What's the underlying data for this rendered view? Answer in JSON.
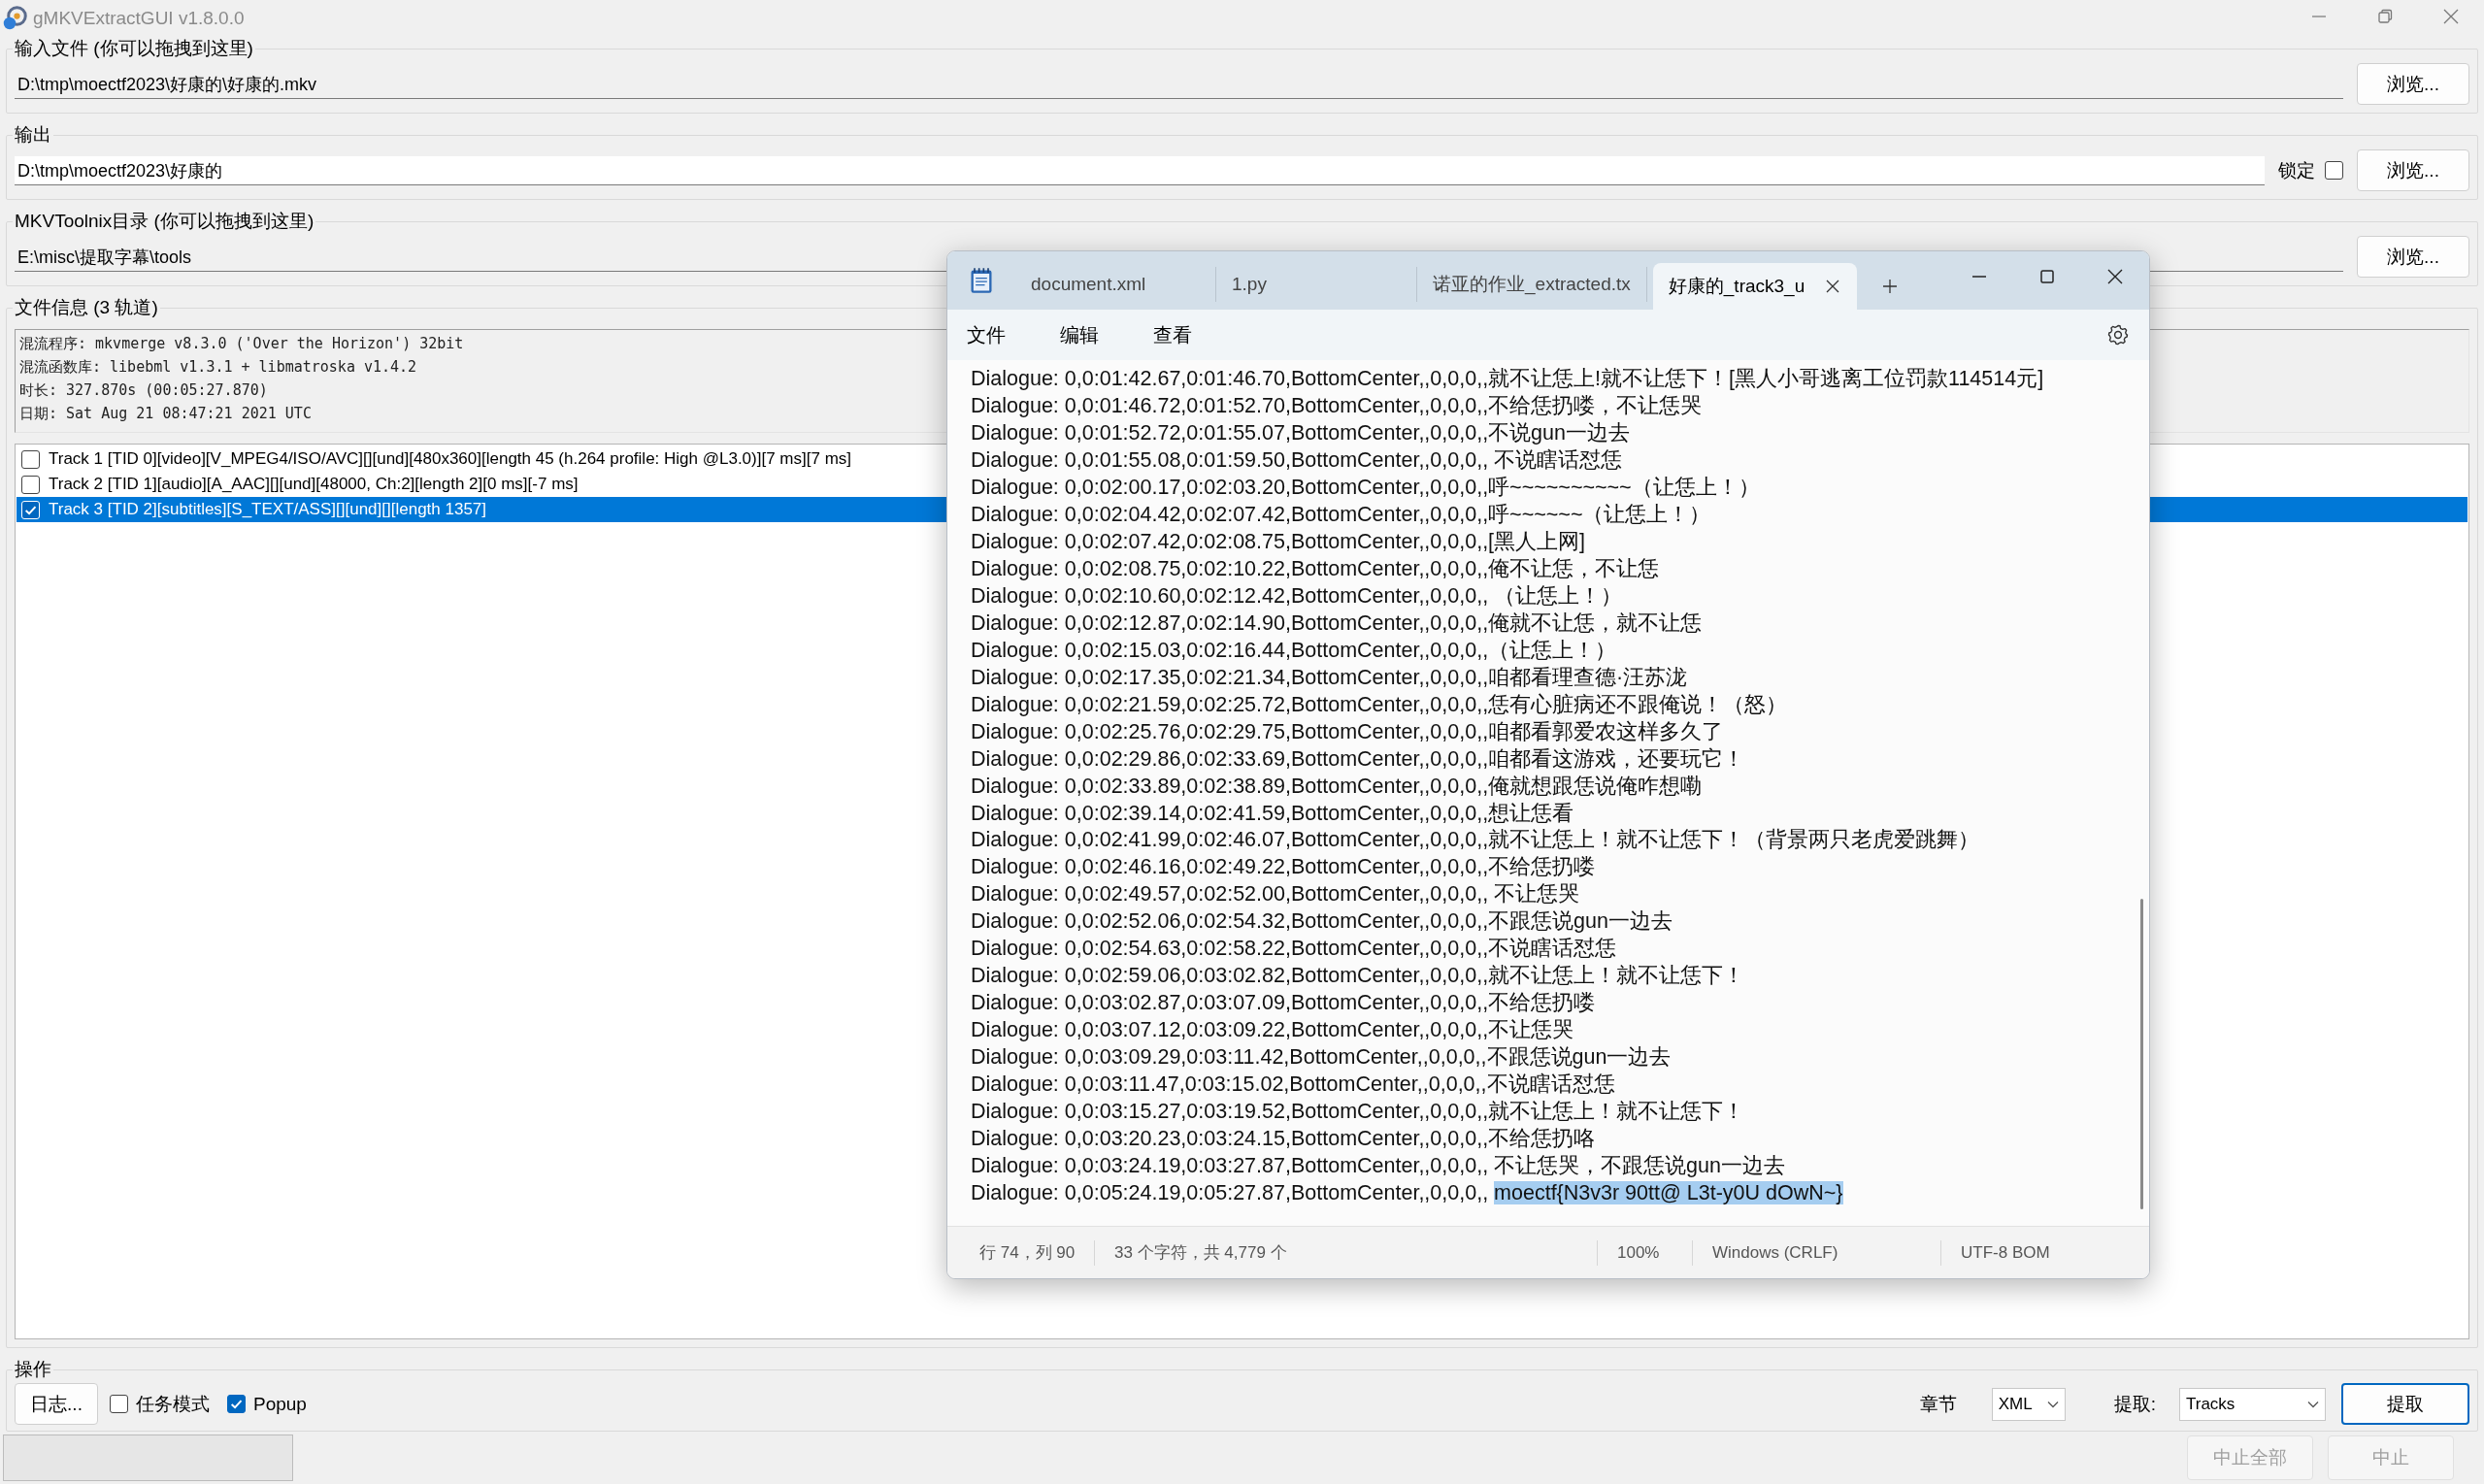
{
  "window": {
    "title": "gMKVExtractGUI v1.8.0.0"
  },
  "input_file": {
    "label": "输入文件 (你可以拖拽到这里)",
    "value": "D:\\tmp\\moectf2023\\好康的\\好康的.mkv",
    "editable": false,
    "browse_button": "浏览..."
  },
  "output": {
    "label": "输出",
    "value": "D:\\tmp\\moectf2023\\好康的",
    "editable": true,
    "lock_label": "锁定",
    "lock_checked": false,
    "browse_button": "浏览..."
  },
  "mkvtoolnix_dir": {
    "label": "MKVToolnix目录 (你可以拖拽到这里)",
    "value": "E:\\misc\\提取字幕\\tools",
    "editable": false,
    "browse_button": "浏览..."
  },
  "file_info": {
    "label": "文件信息 (3 轨道)",
    "details": [
      "混流程序: mkvmerge v8.3.0 ('Over the Horizon') 32bit",
      "混流函数库: libebml v1.3.1 + libmatroska v1.4.2",
      "时长: 327.870s (00:05:27.870)",
      "日期: Sat Aug 21 08:47:21 2021 UTC"
    ],
    "tracks": [
      {
        "label": "Track 1 [TID 0][video][V_MPEG4/ISO/AVC][][und][480x360][length 45 (h.264 profile: High @L3.0)][7 ms][7 ms]",
        "checked": false,
        "selected": false
      },
      {
        "label": "Track 2 [TID 1][audio][A_AAC][][und][48000, Ch:2][length 2][0 ms][-7 ms]",
        "checked": false,
        "selected": false
      },
      {
        "label": "Track 3 [TID 2][subtitles][S_TEXT/ASS][][und][][length 1357]",
        "checked": true,
        "selected": true
      }
    ]
  },
  "actions": {
    "label": "操作",
    "log_button": "日志...",
    "task_mode": {
      "label": "任务模式",
      "checked": false
    },
    "popup": {
      "label": "Popup",
      "checked": true
    },
    "chapters_label": "章节",
    "chapters_format": "XML",
    "extract_label": "提取:",
    "extract_mode": "Tracks",
    "extract_button": "提取"
  },
  "status_bar": {
    "progress": {
      "level": 0
    },
    "abort_all_button": {
      "label": "中止全部",
      "disabled": true
    },
    "abort_button": {
      "label": "中止",
      "disabled": true
    }
  },
  "notepad": {
    "tabs": [
      {
        "label": "document.xml",
        "selected": false
      },
      {
        "label": "1.py",
        "selected": false
      },
      {
        "label": "诺亚的作业_extracted.tx",
        "selected": false
      },
      {
        "label": "好康的_track3_u",
        "selected": true
      }
    ],
    "menu": [
      "文件",
      "编辑",
      "查看"
    ],
    "lines": [
      {
        "text": "Dialogue: 0,0:01:42.67,0:01:46.70,BottomCenter,,0,0,0,,就不让恁上!就不让恁下！[黑人小哥逃离工位罚款114514元]"
      },
      {
        "text": "Dialogue: 0,0:01:46.72,0:01:52.70,BottomCenter,,0,0,0,,不给恁扔喽，不让恁哭"
      },
      {
        "text": "Dialogue: 0,0:01:52.72,0:01:55.07,BottomCenter,,0,0,0,,不说gun一边去"
      },
      {
        "text": "Dialogue: 0,0:01:55.08,0:01:59.50,BottomCenter,,0,0,0,, 不说瞎话怼恁"
      },
      {
        "text": "Dialogue: 0,0:02:00.17,0:02:03.20,BottomCenter,,0,0,0,,呼~~~~~~~~~~（让恁上！）"
      },
      {
        "text": "Dialogue: 0,0:02:04.42,0:02:07.42,BottomCenter,,0,0,0,,呼~~~~~~（让恁上！）"
      },
      {
        "text": "Dialogue: 0,0:02:07.42,0:02:08.75,BottomCenter,,0,0,0,,[黑人上网]"
      },
      {
        "text": "Dialogue: 0,0:02:08.75,0:02:10.22,BottomCenter,,0,0,0,,俺不让恁，不让恁"
      },
      {
        "text": "Dialogue: 0,0:02:10.60,0:02:12.42,BottomCenter,,0,0,0,, （让恁上！）"
      },
      {
        "text": "Dialogue: 0,0:02:12.87,0:02:14.90,BottomCenter,,0,0,0,,俺就不让恁，就不让恁"
      },
      {
        "text": "Dialogue: 0,0:02:15.03,0:02:16.44,BottomCenter,,0,0,0,,（让恁上！）"
      },
      {
        "text": "Dialogue: 0,0:02:17.35,0:02:21.34,BottomCenter,,0,0,0,,咱都看理查德·汪苏泷"
      },
      {
        "text": "Dialogue: 0,0:02:21.59,0:02:25.72,BottomCenter,,0,0,0,,恁有心脏病还不跟俺说！（怒）"
      },
      {
        "text": "Dialogue: 0,0:02:25.76,0:02:29.75,BottomCenter,,0,0,0,,咱都看郭爱农这样多久了"
      },
      {
        "text": "Dialogue: 0,0:02:29.86,0:02:33.69,BottomCenter,,0,0,0,,咱都看这游戏，还要玩它！"
      },
      {
        "text": "Dialogue: 0,0:02:33.89,0:02:38.89,BottomCenter,,0,0,0,,俺就想跟恁说俺咋想嘞"
      },
      {
        "text": "Dialogue: 0,0:02:39.14,0:02:41.59,BottomCenter,,0,0,0,,想让恁看"
      },
      {
        "text": "Dialogue: 0,0:02:41.99,0:02:46.07,BottomCenter,,0,0,0,,就不让恁上！就不让恁下！（背景两只老虎爱跳舞）"
      },
      {
        "text": "Dialogue: 0,0:02:46.16,0:02:49.22,BottomCenter,,0,0,0,,不给恁扔喽"
      },
      {
        "text": "Dialogue: 0,0:02:49.57,0:02:52.00,BottomCenter,,0,0,0,, 不让恁哭"
      },
      {
        "text": "Dialogue: 0,0:02:52.06,0:02:54.32,BottomCenter,,0,0,0,,不跟恁说gun一边去"
      },
      {
        "text": "Dialogue: 0,0:02:54.63,0:02:58.22,BottomCenter,,0,0,0,,不说瞎话怼恁"
      },
      {
        "text": "Dialogue: 0,0:02:59.06,0:03:02.82,BottomCenter,,0,0,0,,就不让恁上！就不让恁下！"
      },
      {
        "text": "Dialogue: 0,0:03:02.87,0:03:07.09,BottomCenter,,0,0,0,,不给恁扔喽"
      },
      {
        "text": "Dialogue: 0,0:03:07.12,0:03:09.22,BottomCenter,,0,0,0,,不让恁哭"
      },
      {
        "text": "Dialogue: 0,0:03:09.29,0:03:11.42,BottomCenter,,0,0,0,,不跟恁说gun一边去"
      },
      {
        "text": "Dialogue: 0,0:03:11.47,0:03:15.02,BottomCenter,,0,0,0,,不说瞎话怼恁"
      },
      {
        "text": "Dialogue: 0,0:03:15.27,0:03:19.52,BottomCenter,,0,0,0,,就不让恁上！就不让恁下！"
      },
      {
        "text": "Dialogue: 0,0:03:20.23,0:03:24.15,BottomCenter,,0,0,0,,不给恁扔咯"
      },
      {
        "text": "Dialogue: 0,0:03:24.19,0:03:27.87,BottomCenter,,0,0,0,, 不让恁哭，不跟恁说gun一边去"
      },
      {
        "text": "Dialogue: 0,0:05:24.19,0:05:27.87,BottomCenter,,0,0,0,, ",
        "selected_text": "moectf{N3v3r 90tt@ L3t-y0U dOwN~}"
      }
    ],
    "status": [
      "行 74，列 90",
      "33 个字符，共 4,779 个",
      "100%",
      "Windows (CRLF)",
      "UTF-8 BOM"
    ]
  }
}
